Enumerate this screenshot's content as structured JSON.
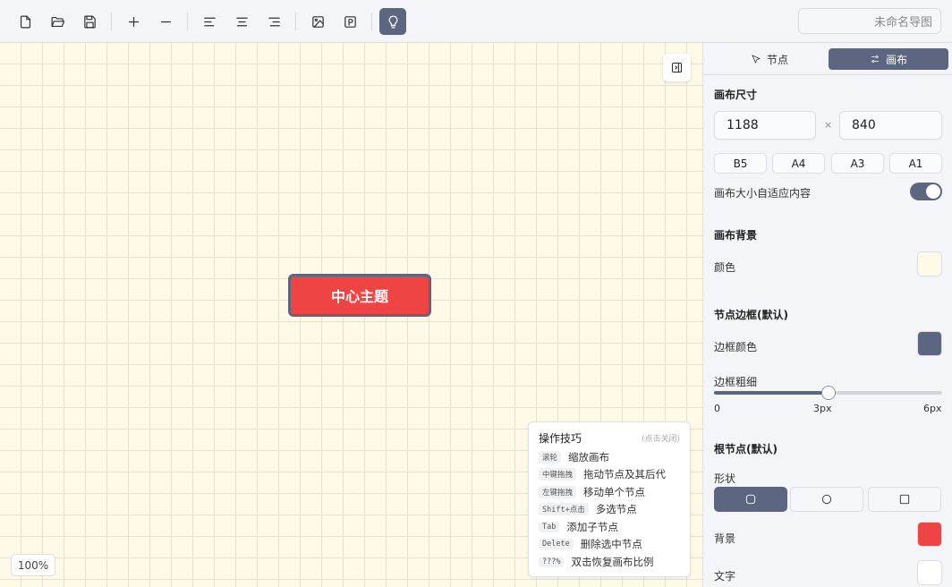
{
  "toolbar": {
    "buttons": [
      {
        "name": "new-file-button",
        "icon": "new-file-icon"
      },
      {
        "name": "open-folder-button",
        "icon": "folder-open-icon"
      },
      {
        "name": "save-button",
        "icon": "save-icon"
      },
      {
        "name": "add-node-button",
        "icon": "plus-icon"
      },
      {
        "name": "remove-node-button",
        "icon": "minus-icon"
      },
      {
        "name": "align-left-button",
        "icon": "align-left-icon"
      },
      {
        "name": "align-center-button",
        "icon": "align-center-icon"
      },
      {
        "name": "align-right-button",
        "icon": "align-right-icon"
      },
      {
        "name": "insert-image-button",
        "icon": "image-icon"
      },
      {
        "name": "export-button",
        "icon": "p-box-icon"
      },
      {
        "name": "tips-button",
        "icon": "lightbulb-icon",
        "active": true
      }
    ],
    "title": "未命名导图"
  },
  "canvas": {
    "root_node_label": "中心主题",
    "zoom": "100%",
    "tips": {
      "title": "操作技巧",
      "close_hint": "(点击关闭)",
      "items": [
        {
          "key": "滚轮",
          "desc": "缩放画布"
        },
        {
          "key": "中键拖拽",
          "desc": "拖动节点及其后代"
        },
        {
          "key": "左键拖拽",
          "desc": "移动单个节点"
        },
        {
          "key": "Shift+点击",
          "desc": "多选节点"
        },
        {
          "key": "Tab",
          "desc": "添加子节点"
        },
        {
          "key": "Delete",
          "desc": "删除选中节点"
        },
        {
          "key": "???%",
          "desc": "双击恢复画布比例"
        }
      ]
    }
  },
  "panel": {
    "tabs": [
      {
        "label": "节点",
        "icon": "cursor-icon",
        "active": false
      },
      {
        "label": "画布",
        "icon": "sliders-icon",
        "active": true
      }
    ],
    "canvas_size": {
      "title": "画布尺寸",
      "width": "1188",
      "times": "×",
      "height": "840",
      "presets": [
        "B5",
        "A4",
        "A3",
        "A1"
      ],
      "auto_fit_label": "画布大小自适应内容",
      "auto_fit_on": true
    },
    "background": {
      "title": "画布背景",
      "color_label": "颜色",
      "color": "#fffae8"
    },
    "node_border": {
      "title": "节点边框(默认)",
      "color_label": "边框颜色",
      "color": "#5c6680",
      "width_label": "边框粗细",
      "slider_min": "0",
      "slider_value": "3px",
      "slider_max": "6px",
      "slider_fraction": 0.5
    },
    "root_node": {
      "title": "根节点(默认)",
      "shape_label": "形状",
      "shapes": [
        {
          "name": "rounded-rect",
          "icon": "rounded-square-icon",
          "active": true
        },
        {
          "name": "circle",
          "icon": "circle-icon",
          "active": false
        },
        {
          "name": "square",
          "icon": "square-icon",
          "active": false
        }
      ],
      "bg_label": "背景",
      "bg_color": "#ef4444",
      "text_label": "文字",
      "text_color": "#ffffff"
    }
  }
}
